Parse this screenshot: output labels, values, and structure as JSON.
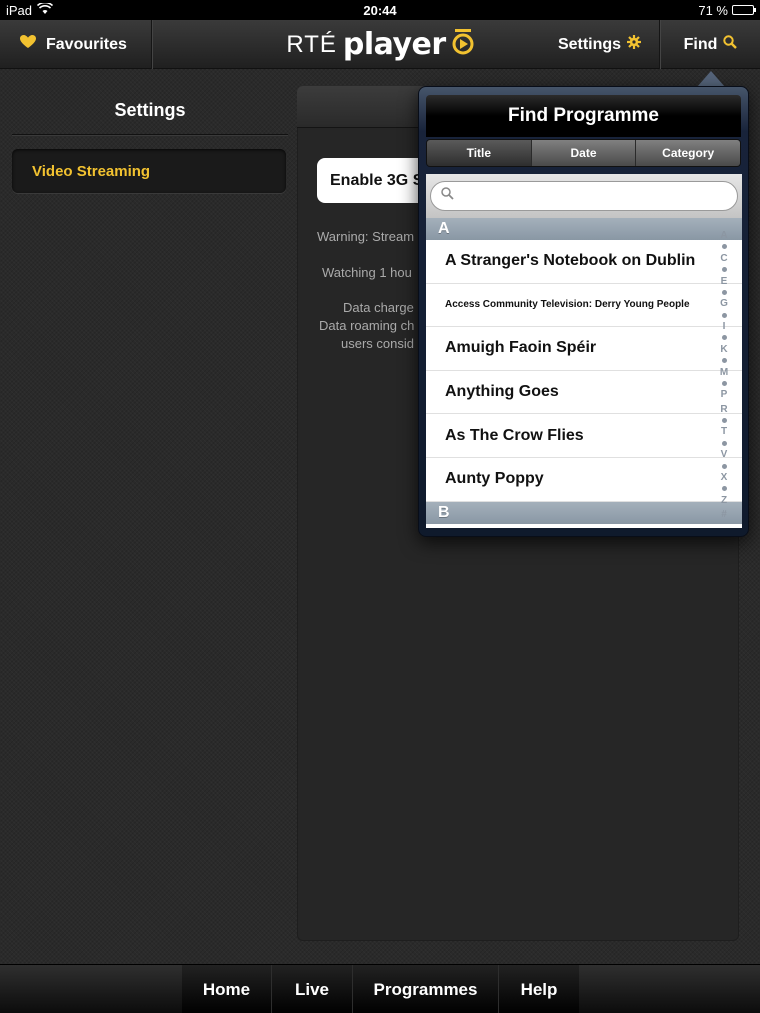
{
  "status_bar": {
    "device": "iPad",
    "time": "20:44",
    "battery": "71 %",
    "battery_level": 0.71
  },
  "nav": {
    "favourites_label": "Favourites",
    "logo_rte": "RTÉ",
    "logo_player": "player",
    "settings_label": "Settings",
    "find_label": "Find"
  },
  "settings": {
    "title": "Settings",
    "menu_items": [
      {
        "label": "Video Streaming"
      }
    ]
  },
  "detail": {
    "enable_label": "Enable 3G S",
    "warning_lines": [
      "Warning: Stream",
      "Watching 1 hou",
      "Data charge",
      "Data roaming ch",
      "users consid"
    ]
  },
  "find_popover": {
    "title": "Find Programme",
    "tabs": [
      "Title",
      "Date",
      "Category"
    ],
    "search_value": "",
    "sections": [
      {
        "letter": "A",
        "items": [
          "A Stranger's Notebook on Dublin",
          "Access Community Television: Derry Young People",
          "Amuigh Faoin Spéir",
          "Anything Goes",
          "As The Crow Flies",
          "Aunty Poppy"
        ]
      },
      {
        "letter": "B",
        "items": []
      }
    ],
    "index_letters": [
      "A",
      "C",
      "E",
      "G",
      "I",
      "K",
      "M",
      "P",
      "R",
      "T",
      "V",
      "X",
      "Z",
      "#"
    ]
  },
  "tab_bar": {
    "tabs": [
      "Home",
      "Live",
      "Programmes",
      "Help"
    ]
  },
  "colors": {
    "accent": "#f2c230",
    "background": "#2a2a2a",
    "section_header": "#95a2ae"
  },
  "icons": {
    "favourites": "heart-icon",
    "settings": "gear-icon",
    "find": "search-icon",
    "logo_play": "play-circle-icon"
  }
}
